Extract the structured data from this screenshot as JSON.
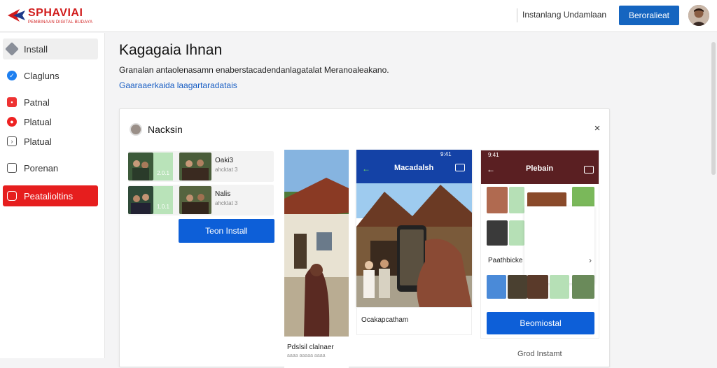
{
  "header": {
    "logo_text": "SPHAVIAI",
    "logo_sub": "PEMBINAAN DIGITAL BUDAYA",
    "link_label": "Instanlang Undamlaan",
    "button_label": "Beroralieat",
    "colors": {
      "brand": "#d11c1c",
      "primary": "#1565c0"
    }
  },
  "sidebar": {
    "items": [
      {
        "label": "Install",
        "icon": "tag-icon"
      },
      {
        "label": "Clagluns",
        "icon": "bird-icon"
      },
      {
        "label": "Patnal",
        "icon": "box-icon"
      },
      {
        "label": "Platual",
        "icon": "circle-icon"
      },
      {
        "label": "Platual",
        "icon": "mail-icon"
      },
      {
        "label": "Porenan",
        "icon": "square-icon"
      },
      {
        "label": "Peatalioltins",
        "icon": "chat-icon"
      }
    ]
  },
  "main": {
    "title": "Kagagaia Ihnan",
    "description": "Granalan antaolenasamn enaberstacadendanlagatalat Meranoaleakano.",
    "link": "Gaaraaerkaida laagartaradatais"
  },
  "card": {
    "title": "Nacksin",
    "close": "×",
    "apps": [
      {
        "title": "Oaki3",
        "sub": "ahcktat 3",
        "badge": "2.0.1"
      },
      {
        "title": "Nalis",
        "sub": "ahcktat 3",
        "badge": "1.0.1"
      }
    ],
    "install_button": "Teon Install",
    "photo1_caption": "Pdslsil clalnaer",
    "photo1_sub": "aaaa aaaaa aaaa",
    "phone1": {
      "status": "9:41",
      "title": "Macadalsh",
      "caption": "Ocakapcatham"
    },
    "phone2": {
      "status": "9:41",
      "title": "Plebain",
      "row_label": "Paathbicke"
    },
    "primary_button": "Beomiostal",
    "secondary_link": "Grod Instamt"
  }
}
